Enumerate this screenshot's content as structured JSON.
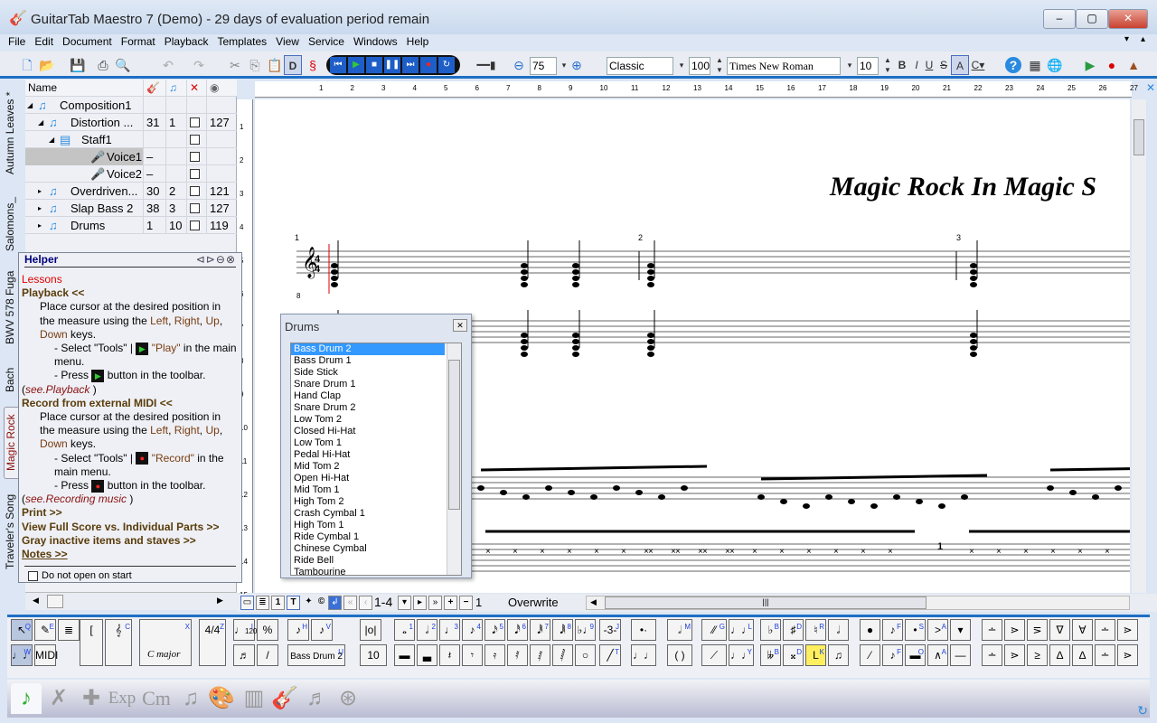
{
  "window": {
    "title": "GuitarTab Maestro 7 (Demo) - 29 days of evaluation period remain",
    "minimize": "▭",
    "maximize": "▢",
    "close": "✕"
  },
  "menu": [
    "File",
    "Edit",
    "Document",
    "Format",
    "Playback",
    "Templates",
    "View",
    "Service",
    "Windows",
    "Help"
  ],
  "toolbar": {
    "zoom": "75",
    "style": "Classic",
    "style_size": "100",
    "font": "Times New Roman",
    "font_size": "10",
    "bold": "B",
    "italic": "I",
    "underline": "U",
    "strike": "S",
    "text_a": "A",
    "d_label": "D"
  },
  "vertical_tabs": [
    "Autumn Leaves *",
    "Salomons_",
    "BWV 578 Fuga",
    "Bach",
    "Magic Rock",
    "Traveler's Song"
  ],
  "tree": {
    "header": "Name",
    "rows": [
      {
        "name": "Composition1",
        "c1": "",
        "c2": "",
        "chk": false,
        "c4": ""
      },
      {
        "name": "Distortion ...",
        "c1": "31",
        "c2": "1",
        "chk": true,
        "c4": "127"
      },
      {
        "name": "Staff1",
        "c1": "",
        "c2": "",
        "chk": true,
        "c4": ""
      },
      {
        "name": "Voice1",
        "c1": "–",
        "c2": "",
        "chk": true,
        "c4": "",
        "selected": true
      },
      {
        "name": "Voice2",
        "c1": "–",
        "c2": "",
        "chk": true,
        "c4": ""
      },
      {
        "name": "Overdriven...",
        "c1": "30",
        "c2": "2",
        "chk": true,
        "c4": "121"
      },
      {
        "name": "Slap Bass 2",
        "c1": "38",
        "c2": "3",
        "chk": true,
        "c4": "127"
      },
      {
        "name": "Drums",
        "c1": "1",
        "c2": "10",
        "chk": true,
        "c4": "119"
      }
    ]
  },
  "helper": {
    "title": "Helper",
    "lessons": "Lessons",
    "playback": "Playback <<",
    "place1": "Place cursor at the desired position in the measure using the",
    "left": "Left",
    "right": "Right",
    "up": "Up",
    "down": "Down",
    "keys": "keys.",
    "select": "- Select \"Tools\" |",
    "play": "\"Play\"",
    "in_menu": "in the main menu.",
    "press": "- Press",
    "btn_toolbar": "button in the toolbar.",
    "see_playback": "see.Playback",
    "record_hdr": "Record from external MIDI <<",
    "record": "\"Record\"",
    "see_record": "see.Recording music",
    "print": "Print >>",
    "fullscore": "View Full Score vs. Individual Parts >>",
    "gray": "Gray inactive items and staves >>",
    "notes": "Notes >>",
    "donot": "Do not open on start"
  },
  "ruler": [
    "1",
    "2",
    "3",
    "4",
    "5",
    "6",
    "7",
    "8",
    "9",
    "10",
    "11",
    "12",
    "13",
    "14",
    "15",
    "16",
    "17",
    "18",
    "19",
    "20",
    "21",
    "22",
    "23",
    "24",
    "25",
    "26",
    "27"
  ],
  "vruler": [
    "1",
    "2",
    "3",
    "4",
    "5",
    "6",
    "7",
    "8",
    "9",
    "10",
    "11",
    "12",
    "13",
    "14",
    "15"
  ],
  "score": {
    "title": "Magic Rock In Magic S",
    "measures": [
      "1",
      "2",
      "3"
    ],
    "time_sig": "4/4",
    "clef_8": "8",
    "tab_mark": "1"
  },
  "drums": {
    "title": "Drums",
    "items": [
      "Bass Drum 2",
      "Bass Drum 1",
      "Side Stick",
      "Snare Drum 1",
      "Hand Clap",
      "Snare Drum 2",
      "Low Tom 2",
      "Closed Hi-Hat",
      "Low Tom 1",
      "Pedal Hi-Hat",
      "Mid Tom 2",
      "Open Hi-Hat",
      "Mid Tom 1",
      "High Tom 2",
      "Crash Cymbal 1",
      "High Tom 1",
      "Ride Cymbal 1",
      "Chinese Cymbal",
      "Ride Bell",
      "Tambourine"
    ],
    "selected": "Bass Drum 2"
  },
  "status": {
    "range": "1-4",
    "voice": "1",
    "mode": "Overwrite",
    "plus": "+",
    "minus": "−"
  },
  "palette": {
    "midi": "MIDI",
    "key": "C major",
    "tempo": "120",
    "drum": "Bass Drum 2",
    "size": "10",
    "shortcuts": [
      "Q",
      "E",
      "C",
      "X",
      "Z",
      "I",
      "H",
      "V",
      "1",
      "2",
      "3",
      "4",
      "5",
      "6",
      "7",
      "8",
      "9",
      "J",
      "M",
      "G",
      "L",
      "B",
      "D",
      "R",
      "F",
      "S",
      "A",
      "W",
      "U",
      "T",
      "Y",
      "K",
      "O"
    ]
  },
  "bottom_tabs": [
    "notes",
    "tools",
    "add-ons",
    "Exp",
    "Cm",
    "chords",
    "palette",
    "keyboard",
    "guitar",
    "mixer",
    "compass"
  ],
  "colors": {
    "accent": "#1e6fc4",
    "selection": "#3399ff",
    "helper_heading": "#5a3c0a",
    "link": "#8b1010"
  }
}
